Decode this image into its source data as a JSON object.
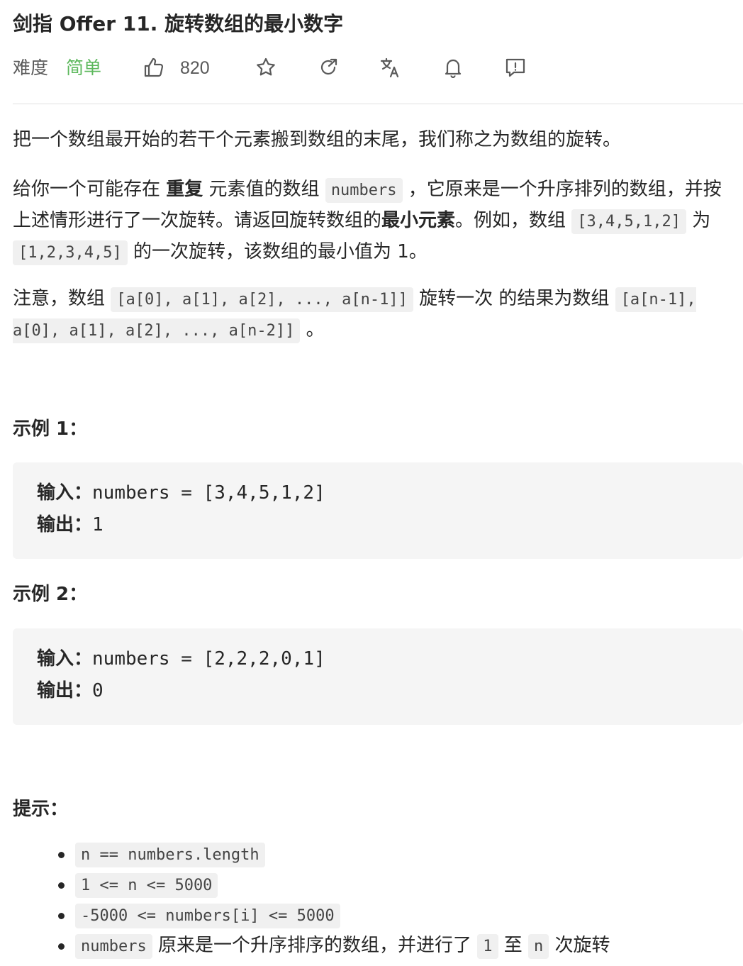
{
  "problem": {
    "title": "剑指 Offer 11. 旋转数组的最小数字",
    "difficulty_label": "难度",
    "difficulty_value": "简单",
    "likes": "820"
  },
  "toolbar": {
    "icons": [
      "thumbs-up-icon",
      "star-icon",
      "share-icon",
      "translate-icon",
      "bell-icon",
      "feedback-icon"
    ],
    "accent_color": "#5cb85c"
  },
  "description": {
    "p1": "把一个数组最开始的若干个元素搬到数组的末尾，我们称之为数组的旋转。",
    "p2": {
      "t1": "给你一个可能存在 ",
      "b1": "重复",
      "t2": " 元素值的数组 ",
      "c1": "numbers",
      "t3": " ，它原来是一个升序排列的数组，并按上述情形进行了一次旋转。请返回旋转数组的",
      "b2": "最小元素",
      "t4": "。例如，数组 ",
      "c2": "[3,4,5,1,2]",
      "t5": " 为 ",
      "c3": "[1,2,3,4,5]",
      "t6": " 的一次旋转，该数组的最小值为 1。"
    },
    "p3": {
      "t1": "注意，数组 ",
      "c1": "[a[0], a[1], a[2], ..., a[n-1]]",
      "t2": " 旋转一次 的结果为数组 ",
      "c2": "[a[n-1], a[0], a[1], a[2], ..., a[n-2]]",
      "t3": " 。"
    }
  },
  "examples": [
    {
      "heading": "示例 1：",
      "input_label": "输入：",
      "input_value": "numbers = [3,4,5,1,2]",
      "output_label": "输出：",
      "output_value": "1"
    },
    {
      "heading": "示例 2：",
      "input_label": "输入：",
      "input_value": "numbers = [2,2,2,0,1]",
      "output_label": "输出：",
      "output_value": "0"
    }
  ],
  "tips": {
    "heading": "提示：",
    "items": [
      {
        "code": "n == numbers.length"
      },
      {
        "code": "1 <= n <= 5000"
      },
      {
        "code": "-5000 <= numbers[i] <= 5000"
      },
      {
        "code": "numbers",
        "t1": " 原来是一个升序排序的数组，并进行了 ",
        "c2": "1",
        "t2": " 至 ",
        "c3": "n",
        "t3": " 次旋转"
      }
    ]
  }
}
